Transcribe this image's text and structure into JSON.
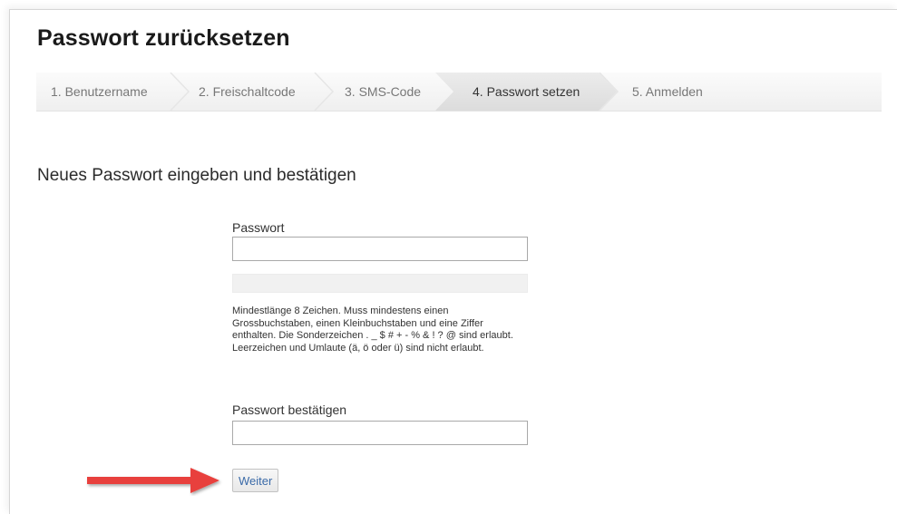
{
  "page": {
    "title": "Passwort zurücksetzen",
    "subtitle": "Neues Passwort eingeben und bestätigen"
  },
  "steps": [
    {
      "label": "1. Benutzername",
      "active": false
    },
    {
      "label": "2. Freischaltcode",
      "active": false
    },
    {
      "label": "3. SMS-Code",
      "active": false
    },
    {
      "label": "4. Passwort setzen",
      "active": true
    },
    {
      "label": "5. Anmelden",
      "active": false
    }
  ],
  "form": {
    "password_label": "Passwort",
    "password_value": "",
    "password_strength": 0,
    "hint": "Mindestlänge 8 Zeichen. Muss mindestens einen Grossbuchstaben, einen Kleinbuchstaben und eine Ziffer enthalten. Die Sonderzeichen . _ $ # + - % & ! ? @ sind erlaubt. Leerzeichen und Umlaute (ä, ö oder ü) sind nicht erlaubt.",
    "confirm_label": "Passwort bestätigen",
    "confirm_value": "",
    "submit_label": "Weiter"
  },
  "annotation": {
    "icon": "red-arrow-icon",
    "color": "#e8403c"
  },
  "colors": {
    "step_active_bg": "#e1e1e1",
    "button_text": "#3a6aa8"
  }
}
